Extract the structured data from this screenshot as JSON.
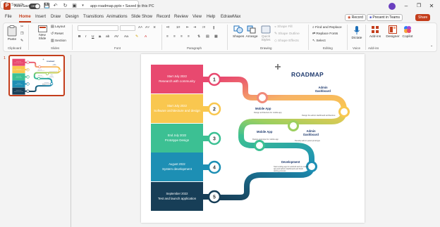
{
  "titlebar": {
    "autosave_label": "AutoSave",
    "autosave_state": "Off",
    "file_title": "app-roadmap.pptx • Saved to this PC",
    "search_placeholder": "Search"
  },
  "tabs": [
    "File",
    "Home",
    "Insert",
    "Draw",
    "Design",
    "Transitions",
    "Animations",
    "Slide Show",
    "Record",
    "Review",
    "View",
    "Help",
    "EdrawMax"
  ],
  "active_tab": "Home",
  "actions": {
    "record": "Record",
    "present_teams": "Present in Teams",
    "share": "Share"
  },
  "ribbon": {
    "clipboard": {
      "paste": "Paste",
      "label": "Clipboard"
    },
    "slides": {
      "new_slide": "New Slide",
      "layout": "Layout",
      "reset": "Reset",
      "section": "Section",
      "label": "Slides"
    },
    "font": {
      "label": "Font"
    },
    "paragraph": {
      "label": "Paragraph"
    },
    "drawing": {
      "shapes": "Shapes",
      "arrange": "Arrange",
      "quick_styles": "Quick Styles",
      "shape_fill": "Shape Fill",
      "shape_outline": "Shape Outline",
      "shape_effects": "Shape Effects",
      "label": "Drawing"
    },
    "editing": {
      "find_replace": "Find and Replace",
      "replace_fonts": "Replace Fonts",
      "select": "Select",
      "label": "Editing"
    },
    "voice": {
      "dictate": "Dictate",
      "label": "Voice"
    },
    "addins": {
      "add_ins": "Add-ins",
      "label": "Add-ins"
    },
    "designer": "Designer",
    "copilot": "Copilot"
  },
  "thumbnail": {
    "slide_number": "1"
  },
  "slide": {
    "title": "ROADMAP",
    "blocks": [
      {
        "date": "Start July 2022",
        "text": "Research with community",
        "color": "#e8496f"
      },
      {
        "date": "Start July 2022",
        "text": "Software architecture and design",
        "color": "#f9c74f"
      },
      {
        "date": "End July 2022",
        "text": "Prototype Design",
        "color": "#3cc093"
      },
      {
        "date": "August 2022",
        "text": "System development",
        "color": "#1d8fb4"
      },
      {
        "date": "September 2022",
        "text": "Test and launch application",
        "color": "#173e57"
      }
    ],
    "numbers": [
      "1",
      "2",
      "3",
      "4",
      "5"
    ],
    "milestones": [
      {
        "title": "Mobile App",
        "desc": "Design architecture for mobile app"
      },
      {
        "title": "Admin Dashboard",
        "desc": "Design the admin dashboard architecture"
      },
      {
        "title": "Mobile App",
        "desc": "Design prototype for mobile app"
      },
      {
        "title": "Admin Dashboard",
        "desc": "Develop admin panel prototype"
      },
      {
        "title": "Development",
        "desc": "Start coding app for android and ios mobile app and admin dashboard and finish testing process"
      }
    ]
  }
}
